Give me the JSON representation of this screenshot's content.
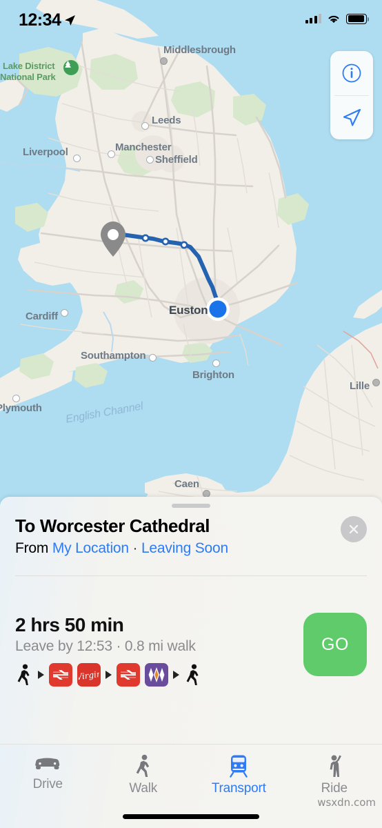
{
  "status_bar": {
    "time": "12:34",
    "location_icon": "location-arrow-icon",
    "cellular_icon": "cellular-bars-icon",
    "wifi_icon": "wifi-icon",
    "battery_icon": "battery-full-icon"
  },
  "map": {
    "controls": [
      {
        "name": "info-button",
        "icon": "info-circle-icon"
      },
      {
        "name": "recenter-button",
        "icon": "navigation-arrow-icon"
      }
    ],
    "labels": [
      {
        "text": "Lake District",
        "type": "park"
      },
      {
        "text": "National Park",
        "type": "park"
      },
      {
        "text": "Middlesbrough",
        "type": "city"
      },
      {
        "text": "Leeds",
        "type": "city"
      },
      {
        "text": "Manchester",
        "type": "city"
      },
      {
        "text": "Sheffield",
        "type": "city"
      },
      {
        "text": "Liverpool",
        "type": "city"
      },
      {
        "text": "Cardiff",
        "type": "city"
      },
      {
        "text": "Euston",
        "type": "city"
      },
      {
        "text": "Southampton",
        "type": "city"
      },
      {
        "text": "Brighton",
        "type": "city"
      },
      {
        "text": "Plymouth",
        "type": "city"
      },
      {
        "text": "Lille",
        "type": "city"
      },
      {
        "text": "Caen",
        "type": "city"
      },
      {
        "text": "English Channel",
        "type": "water"
      }
    ],
    "colors": {
      "sea": "#AEDCF0",
      "land": "#F2EFE9",
      "park": "#D6E8CC",
      "route": "#2563B0",
      "current_location": "#1A73E8",
      "pin": "#8A8A8A"
    }
  },
  "sheet": {
    "destination_title": "To Worcester Cathedral",
    "from_prefix": "From",
    "from_location": "My Location",
    "separator": "·",
    "departure": "Leaving Soon",
    "close_icon": "close-icon",
    "grabber": "sheet-drag-handle"
  },
  "route": {
    "duration": "2 hrs 50 min",
    "detail": "Leave by 12:53 · 0.8 mi walk",
    "go_label": "GO",
    "go_color": "#5FCB6A",
    "legs": [
      {
        "kind": "walk",
        "name": "walk-icon"
      },
      {
        "kind": "chevron",
        "name": "chevron-right-icon"
      },
      {
        "kind": "rail",
        "name": "national-rail-icon"
      },
      {
        "kind": "virgin",
        "name": "virgin-trains-icon"
      },
      {
        "kind": "chevron",
        "name": "chevron-right-icon"
      },
      {
        "kind": "rail",
        "name": "national-rail-icon"
      },
      {
        "kind": "wmr",
        "name": "west-midlands-railway-icon"
      },
      {
        "kind": "chevron",
        "name": "chevron-right-icon"
      },
      {
        "kind": "walk",
        "name": "walk-icon"
      }
    ]
  },
  "tabs": [
    {
      "label": "Drive",
      "icon": "car-icon",
      "active": false
    },
    {
      "label": "Walk",
      "icon": "walk-icon",
      "active": false
    },
    {
      "label": "Transport",
      "icon": "train-icon",
      "active": true
    },
    {
      "label": "Ride",
      "icon": "hailing-person-icon",
      "active": false
    }
  ],
  "watermark": "wsxdn.com"
}
